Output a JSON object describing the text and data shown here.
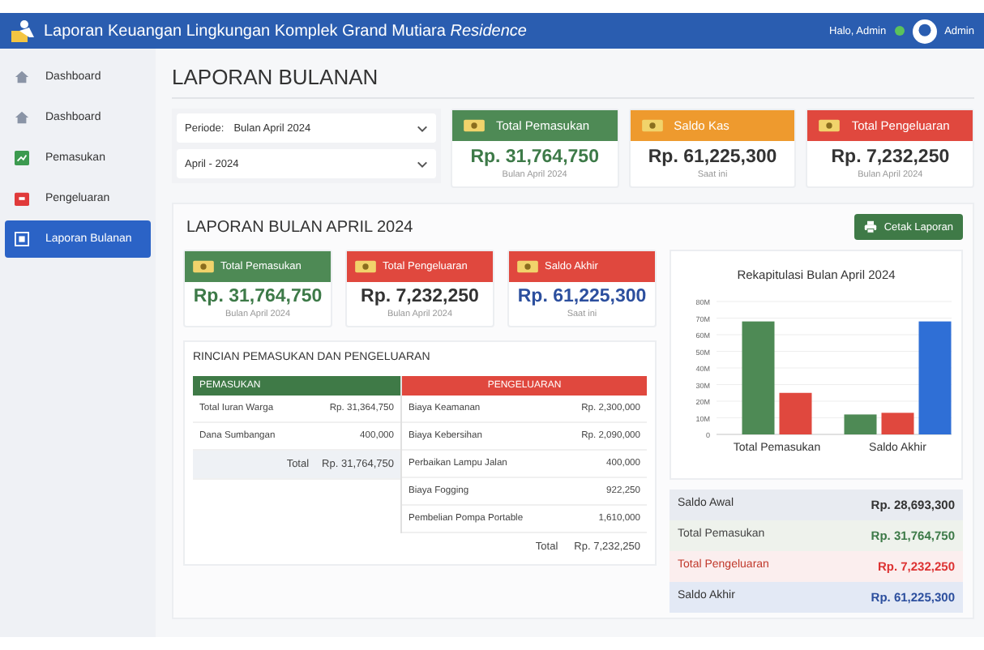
{
  "header": {
    "title": "Laporan Keuangan Lingkungan Komplek Grand Mutiara *Residence*",
    "greeting": "Halo, Admin",
    "user": "Admin"
  },
  "sidebar": {
    "items": [
      {
        "label": "Dashboard",
        "kind": "home",
        "selected": false
      },
      {
        "label": "Dashboard",
        "kind": "home",
        "selected": false
      },
      {
        "label": "Pemasukan",
        "kind": "income",
        "selected": false
      },
      {
        "label": "Pengeluaran",
        "kind": "expense",
        "selected": false
      },
      {
        "label": "Laporan Bulanan",
        "kind": "report",
        "selected": true
      }
    ]
  },
  "page_title": "LAPORAN BULANAN",
  "filters": [
    {
      "label": "Periode:",
      "value": "Bulan April 2024"
    },
    {
      "value": "April - 2024"
    }
  ],
  "stat_cards": [
    {
      "kind": "income",
      "title": "Total Pemasukan",
      "value": "Rp. 31,764,750",
      "note": "Bulan April 2024"
    },
    {
      "kind": "cash",
      "title": "Saldo Kas",
      "value": "Rp. 61,225,300",
      "note": "Saat ini"
    },
    {
      "kind": "expense",
      "title": "Total Pengeluaran",
      "value": "Rp. 7,232,250",
      "note": "Bulan April 2024"
    }
  ],
  "report": {
    "title": "LAPORAN BULAN APRIL 2024",
    "print_button": "Cetak Laporan",
    "cards": [
      {
        "kind": "income",
        "title": "Total Pemasukan",
        "value": "Rp. 31,764,750",
        "note": "Bulan April 2024"
      },
      {
        "kind": "expense",
        "title": "Total Pengeluaran",
        "value": "Rp. 7,232,250",
        "note": "Bulan April 2024"
      },
      {
        "kind": "balance",
        "title": "Saldo Akhir",
        "value": "Rp. 61,225,300",
        "note": "Saat ini"
      }
    ],
    "detail_title": "RINCIAN PEMASUKAN DAN PENGELUARAN",
    "income": {
      "heading": "PEMASUKAN",
      "rows": [
        {
          "label": "Total Iuran Warga",
          "amount": "Rp. 31,364,750"
        },
        {
          "label": "Dana Sumbangan",
          "amount": "400,000"
        }
      ],
      "total_label": "Total",
      "total": "Rp. 31,764,750"
    },
    "expense": {
      "heading": "PENGELUARAN",
      "rows": [
        {
          "label": "Biaya Keamanan",
          "amount": "Rp. 2,300,000"
        },
        {
          "label": "Biaya Kebersihan",
          "amount": "Rp. 2,090,000"
        },
        {
          "label": "Perbaikan Lampu Jalan",
          "amount": "400,000"
        },
        {
          "label": "Biaya Fogging",
          "amount": "922,250"
        },
        {
          "label": "Pembelian Pompa Portable",
          "amount": "1,610,000"
        }
      ],
      "total_label": "Total",
      "total": "Rp. 7,232,250"
    },
    "chart_data": {
      "type": "bar",
      "title": "Rekapitulasi Bulan April 2024",
      "categories": [
        "Total Pemasukan",
        "Saldo Akhir"
      ],
      "series": [
        {
          "color": "#4e8a55",
          "values": [
            68,
            12
          ]
        },
        {
          "color": "#e0483e",
          "values": [
            25,
            13
          ]
        },
        {
          "color": "#2f6fd6",
          "values": [
            null,
            68
          ]
        }
      ],
      "ylim": [
        0,
        80
      ],
      "grid": true,
      "yticks": [
        {
          "value": 0,
          "label": "0"
        },
        {
          "value": 10,
          "label": "10M"
        },
        {
          "value": 20,
          "label": "20M"
        },
        {
          "value": 30,
          "label": "30M"
        },
        {
          "value": 40,
          "label": "40M"
        },
        {
          "value": 50,
          "label": "50M"
        },
        {
          "value": 60,
          "label": "60M"
        },
        {
          "value": 70,
          "label": "70M"
        },
        {
          "value": 80,
          "label": "80M"
        }
      ]
    },
    "summary": [
      {
        "kind": "opening",
        "label": "Saldo Awal",
        "value": "Rp. 28,693,300"
      },
      {
        "kind": "income",
        "label": "Total Pemasukan",
        "value": "Rp. 31,764,750"
      },
      {
        "kind": "expense",
        "label": "Total Pengeluaran",
        "value": "Rp. 7,232,250"
      },
      {
        "kind": "closing",
        "label": "Saldo Akhir",
        "value": "Rp. 61,225,300"
      }
    ]
  }
}
